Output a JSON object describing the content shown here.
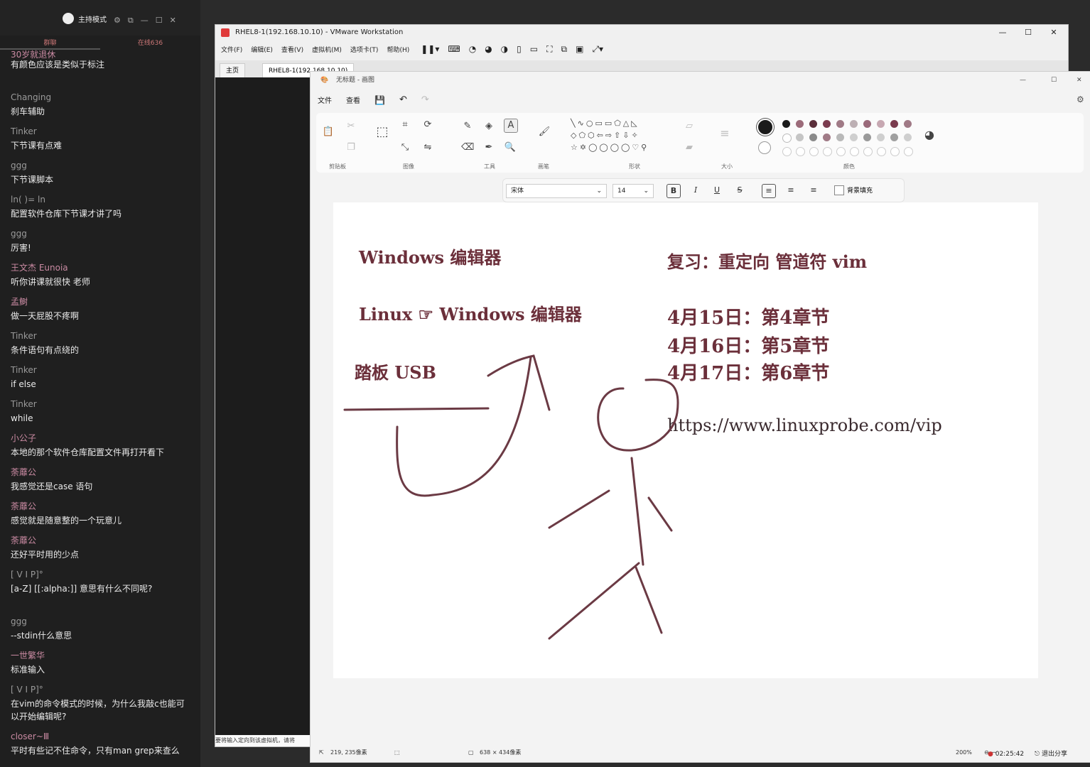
{
  "chat": {
    "host_label": "主持模式",
    "tabs": [
      "群聊",
      "在线636"
    ],
    "partial_top": "30岁就退休",
    "messages": [
      {
        "user": "",
        "text": "有颜色应该是类似于标注"
      },
      {
        "user": "Changing",
        "text": "刹车辅助"
      },
      {
        "user": "Tinker",
        "text": "下节课有点难"
      },
      {
        "user": "ggg",
        "text": "下节课脚本"
      },
      {
        "user": "ln(   )=    ln",
        "text": "配置软件仓库下节课才讲了吗"
      },
      {
        "user": "ggg",
        "text": "厉害!"
      },
      {
        "user": "王文杰 Eunoia",
        "text": "听你讲课就很快 老师"
      },
      {
        "user": "孟鲥",
        "text": "做一天屁股不疼啊"
      },
      {
        "user": "Tinker",
        "text": "条件语句有点绕的"
      },
      {
        "user": "Tinker",
        "text": "if else"
      },
      {
        "user": "Tinker",
        "text": "while"
      },
      {
        "user": "小公子",
        "text": "本地的那个软件仓库配置文件再打开看下"
      },
      {
        "user": "荼蘼公",
        "text": "我感觉还是case  语句"
      },
      {
        "user": "荼蘼公",
        "text": "感觉就是随意整的一个玩意儿"
      },
      {
        "user": "荼蘼公",
        "text": "还好平时用的少点"
      },
      {
        "user": "[     V      I      P]°",
        "text": "[a-Z]   [[:alpha:]]    意思有什么不同呢?"
      },
      {
        "user": "ggg",
        "text": "--stdin什么意思"
      },
      {
        "user": "一世繁华",
        "text": "标准输入"
      },
      {
        "user": "[     V      I      P]°",
        "text": "在vim的命令模式的时候，为什么我敲c也能可以开始编辑呢?"
      },
      {
        "user": "closer~Ⅲ",
        "text": "平时有些记不住命令，只有man  grep来查么"
      }
    ]
  },
  "vmware": {
    "title": "RHEL8-1(192.168.10.10) - VMware Workstation",
    "menu": [
      "文件(F)",
      "编辑(E)",
      "查看(V)",
      "虚拟机(M)",
      "选项卡(T)",
      "帮助(H)"
    ],
    "tabs": [
      "主页",
      "RHEL8-1(192.168.10.10)"
    ],
    "status": "要将输入定向到该虚拟机，请将"
  },
  "paint": {
    "title": "无标题 - 画图",
    "menu": [
      "文件",
      "查看"
    ],
    "groups": [
      "剪贴板",
      "图像",
      "工具",
      "画笔",
      "形状",
      "大小",
      "颜色"
    ],
    "font_name": "宋体",
    "font_size": "14",
    "bg_fill_label": "背景填充",
    "status_pos": "219, 235像素",
    "status_size": "638 × 434像素",
    "zoom": "200%",
    "palette_colors": [
      "#1a1a1a",
      "#9c6b7a",
      "#5a2e3a",
      "#7a3b4e",
      "#a07a86",
      "#bdb0b4",
      "#9a6a7a",
      "#c7a8b2",
      "#7a3b4e",
      "#a07a86",
      "#ffffff",
      "#c5c5c5",
      "#8a8a8a",
      "#a07a86",
      "#b9b9b9",
      "#cfcfcf",
      "#9a9a9a",
      "#cfcfcf",
      "#a0a0a0",
      "#cfcfcf"
    ]
  },
  "canvas": {
    "line1": "Windows 编辑器",
    "line2": "Linux ☞  Windows  编辑器",
    "line3": "踏板 USB",
    "review": "复习：重定向 管道符 vim",
    "dates": [
      "4月15日：第4章节",
      "4月16日：第5章节",
      "4月17日：第6章节"
    ],
    "url": "https://www.linuxprobe.com/vip"
  },
  "taskbar": {
    "clock": "02:25:42",
    "share": "退出分享"
  }
}
